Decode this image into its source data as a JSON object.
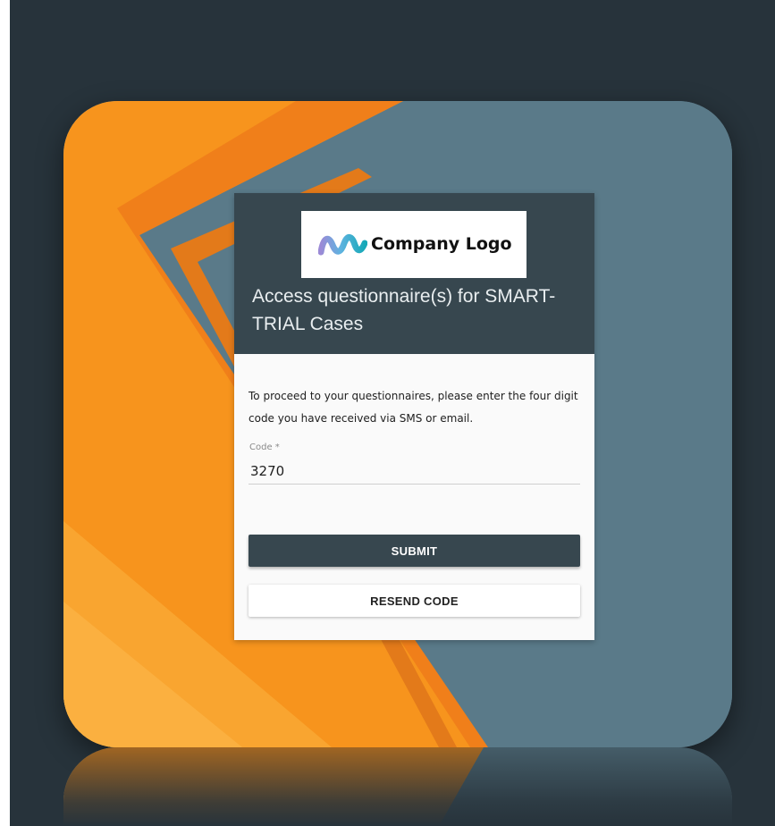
{
  "logo": {
    "text": "Company Logo",
    "icon": "wave-logo-icon"
  },
  "header": {
    "title": "Access questionnaire(s) for SMART-TRIAL Cases"
  },
  "body": {
    "instructions": "To proceed to your questionnaires, please enter the four digit code you have received via SMS or email."
  },
  "code_field": {
    "label": "Code *",
    "value": "3270"
  },
  "buttons": {
    "submit": "SUBMIT",
    "resend": "RESEND CODE"
  },
  "colors": {
    "page_background": "#27333b",
    "header_background": "#37474f",
    "accent_orange": "#f7941d",
    "slate_blue": "#5a7a89",
    "card_background": "#fafafa"
  }
}
